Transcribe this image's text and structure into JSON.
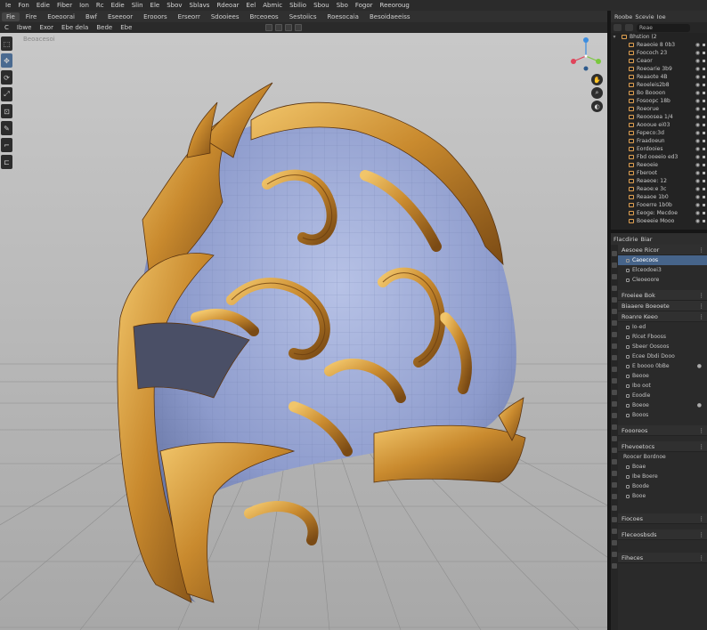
{
  "menubar": [
    "Ie",
    "Fon",
    "Edie",
    "Fiber",
    "Ion",
    "Rc",
    "Edie",
    "Slin",
    "Ele",
    "Sbov",
    "Sblavs",
    "Rdeoar",
    "Eel",
    "Abmic",
    "Sbilio",
    "Sbou",
    "Sbo",
    "Fogor",
    "Reeoroug"
  ],
  "tabs": [
    "Fie",
    "Fire",
    "Eoeoorai",
    "Bwf",
    "Eseeoor",
    "Erooors",
    "Erseorr",
    "Sdooiees",
    "Brceoeos",
    "Sestoiics",
    "Roesocaia",
    "Besoidaeeiss"
  ],
  "header": {
    "items": [
      "C",
      "Ibwe",
      "Exor",
      "Ebe dela",
      "Bede",
      "Ebe"
    ]
  },
  "viewport": {
    "label": "Beoacesoi"
  },
  "tools": [
    "⬚",
    "✥",
    "⟳",
    "⤢",
    "⊡",
    "✎",
    "⌐",
    "⊏"
  ],
  "gizmo": {
    "x_color": "#e0445a",
    "y_color": "#7ac83d",
    "z_color": "#3b8de0"
  },
  "nav": [
    "✋",
    "⌕",
    "◐"
  ],
  "outliner": {
    "title": [
      "Roobe",
      "Scevie",
      "Ioe"
    ],
    "search": "Reae",
    "root": "Bhstion (2",
    "items": [
      "Reaeoie 8 0b3",
      "Foococh 23",
      "Ceaor",
      "Roeoarie 3b9",
      "Reaaote 4B",
      "Reoeleis2b8",
      "Bo Boooon",
      "Fosoopc 18b",
      "Roeorue",
      "Reooosea 1/4",
      "Aoooue ei03",
      "Fepeco:3d",
      "Fraadoeun",
      "Eordooies",
      "Fbd ooeeio ed3",
      "Reeoeie",
      "Fberoot",
      "Reaeoe: 12",
      "Reaoe:e 3c",
      "Reaaoe 1b0",
      "Fooerre 1b0b",
      "Eeoge: Mecdoe",
      "Boeeeie Mooo"
    ]
  },
  "properties": {
    "title": [
      "Flacdirie",
      "Biar"
    ],
    "sec1": "Aesoee Ricor",
    "sec1_rows": [
      "Caoecoos",
      "Elceodoei3",
      "Cleoeoore"
    ],
    "sec2": "Froeiee Bok",
    "sec3": "Biaaere Boeoete",
    "sec4": "Roanre Keeo",
    "sec4_rows": [
      "Io-ed",
      "Rlcet Fbooss",
      "Sbeer Oosoos",
      "Ecee Dbdi Dooo",
      "E boooo 0bBe",
      "Beooe",
      "Ibo oot",
      "Eoodie",
      "Boeoe",
      "Booos"
    ],
    "sec5": "Foooreos",
    "sec6": "Fhevoetocs",
    "sec6_head": "Roocer Bordnoe",
    "sec6_rows": [
      "Boae",
      "Ibe Boere",
      "Boode",
      "Booe"
    ],
    "sec7": "Fiocoes",
    "sec8": "Fleceosbsds",
    "sec9": "Fiheces"
  }
}
